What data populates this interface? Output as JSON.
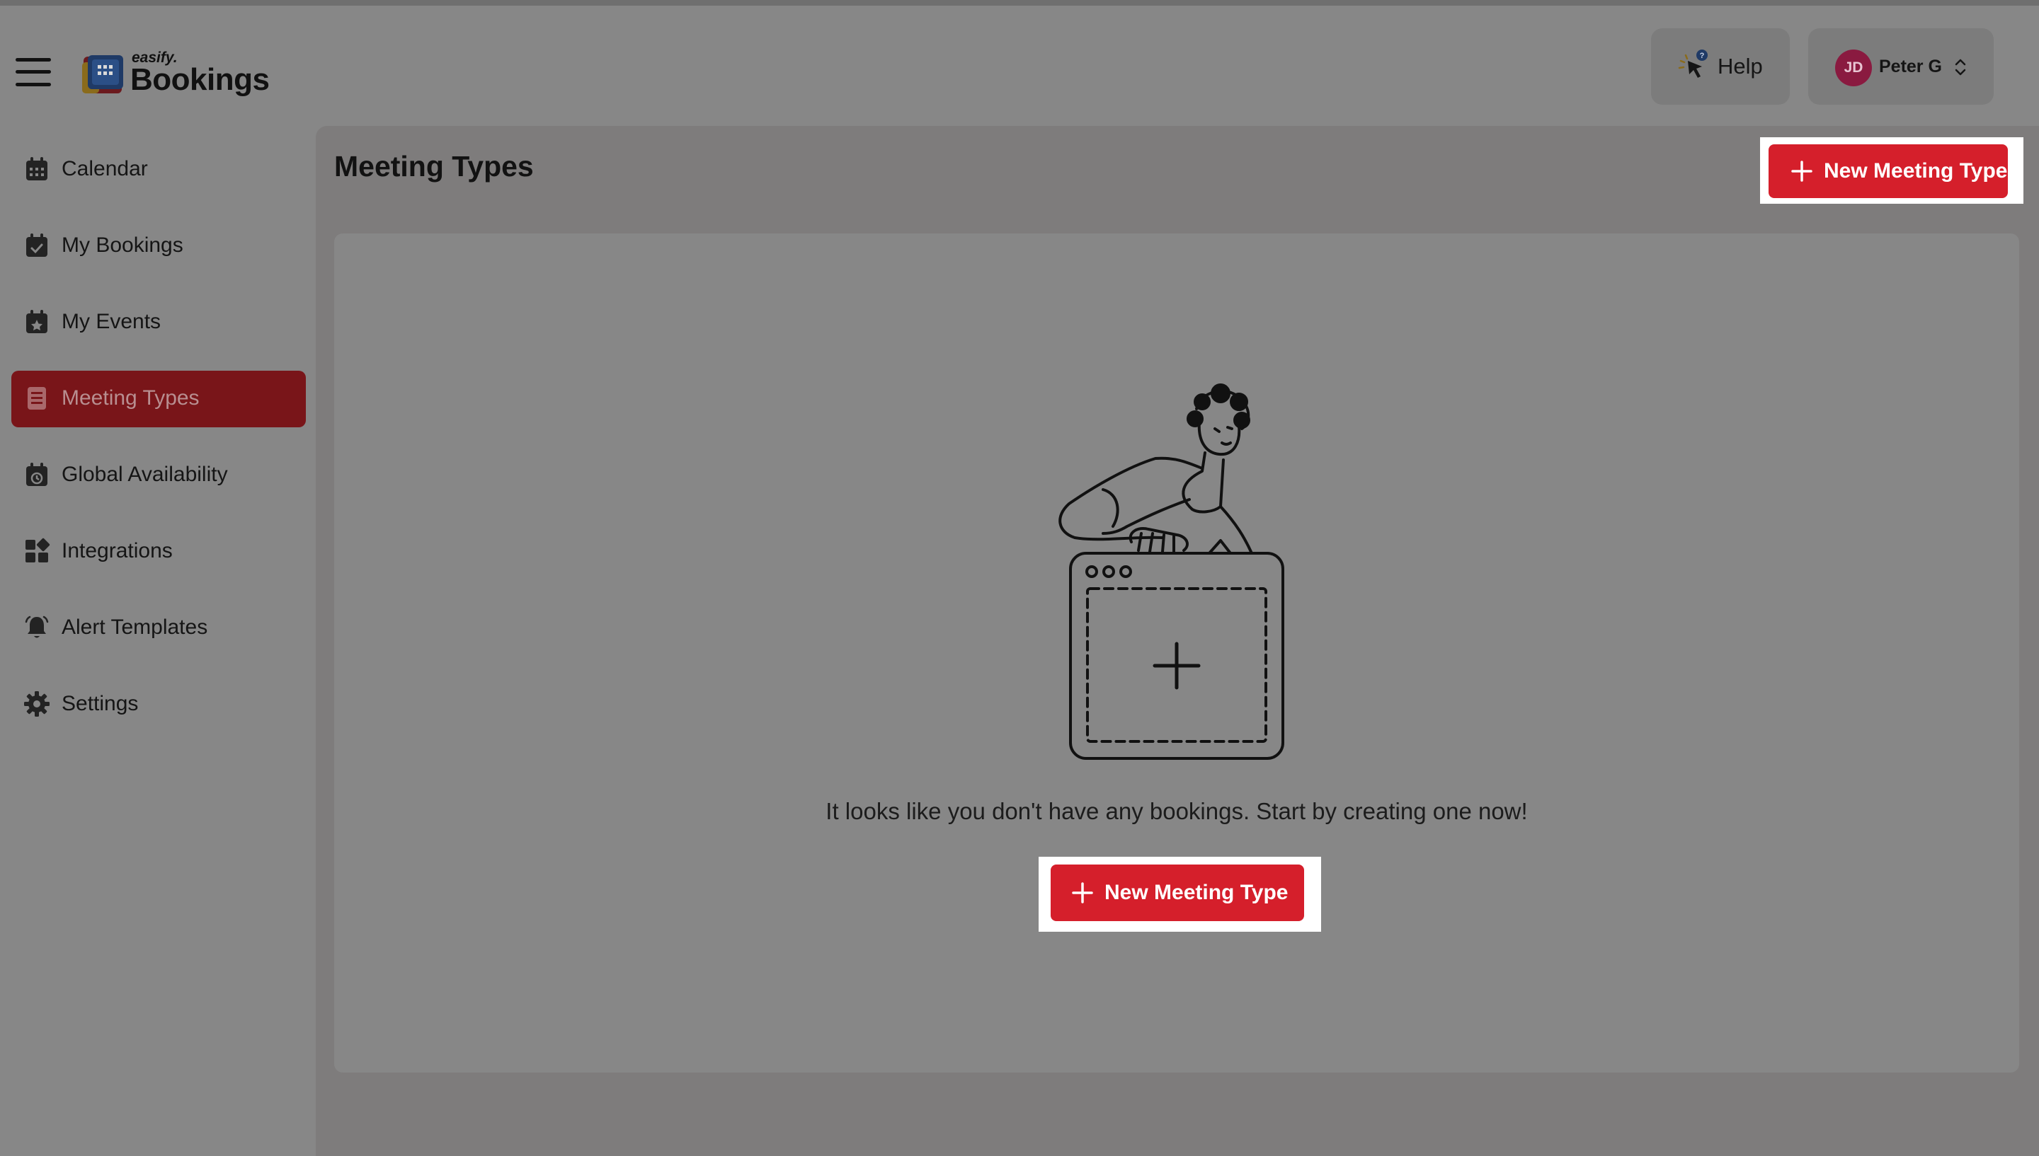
{
  "app": {
    "logo_small": "easify.",
    "logo_big": "Bookings"
  },
  "header": {
    "help_label": "Help",
    "help_badge": "?",
    "user": {
      "initials": "JD",
      "name": "Peter G"
    }
  },
  "sidebar": {
    "items": [
      {
        "label": "Calendar",
        "icon": "calendar-icon",
        "active": false
      },
      {
        "label": "My Bookings",
        "icon": "calendar-check-icon",
        "active": false
      },
      {
        "label": "My Events",
        "icon": "calendar-star-icon",
        "active": false
      },
      {
        "label": "Meeting Types",
        "icon": "list-icon",
        "active": true
      },
      {
        "label": "Global Availability",
        "icon": "calendar-clock-icon",
        "active": false
      },
      {
        "label": "Integrations",
        "icon": "grid-icon",
        "active": false
      },
      {
        "label": "Alert Templates",
        "icon": "bell-icon",
        "active": false
      },
      {
        "label": "Settings",
        "icon": "gear-icon",
        "active": false
      }
    ]
  },
  "main": {
    "title": "Meeting Types",
    "new_button_label": "New Meeting Type",
    "empty_message": "It looks like you don't have any bookings. Start by creating one now!",
    "empty_button_label": "New Meeting Type"
  },
  "colors": {
    "accent": "#d51f2b",
    "active_nav": "#791519",
    "avatar": "#8a1a40",
    "overlay": "#878787"
  }
}
